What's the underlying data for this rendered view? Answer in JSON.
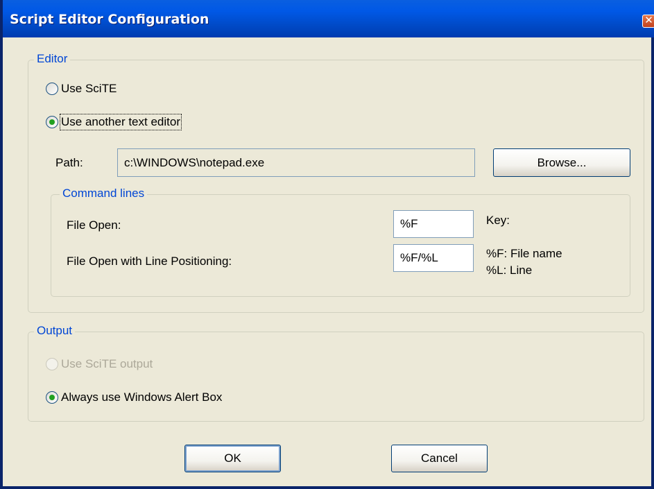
{
  "window": {
    "title": "Script Editor Configuration",
    "close_label": "✕"
  },
  "editor_group": {
    "legend": "Editor",
    "radio_scite": "Use SciTE",
    "radio_other": "Use another text editor",
    "selected": "other",
    "path_label": "Path:",
    "path_value": "c:\\WINDOWS\\notepad.exe",
    "browse_label": "Browse...",
    "command_lines": {
      "legend": "Command lines",
      "file_open_label": "File Open:",
      "file_open_value": "%F",
      "file_open_line_label": "File Open with Line Positioning:",
      "file_open_line_value": "%F/%L",
      "key_label": "Key:",
      "key_f": "%F: File name",
      "key_l": "%L: Line"
    }
  },
  "output_group": {
    "legend": "Output",
    "radio_scite_output": "Use SciTE output",
    "radio_alert": "Always use Windows Alert Box",
    "selected": "alert"
  },
  "buttons": {
    "ok": "OK",
    "cancel": "Cancel"
  }
}
